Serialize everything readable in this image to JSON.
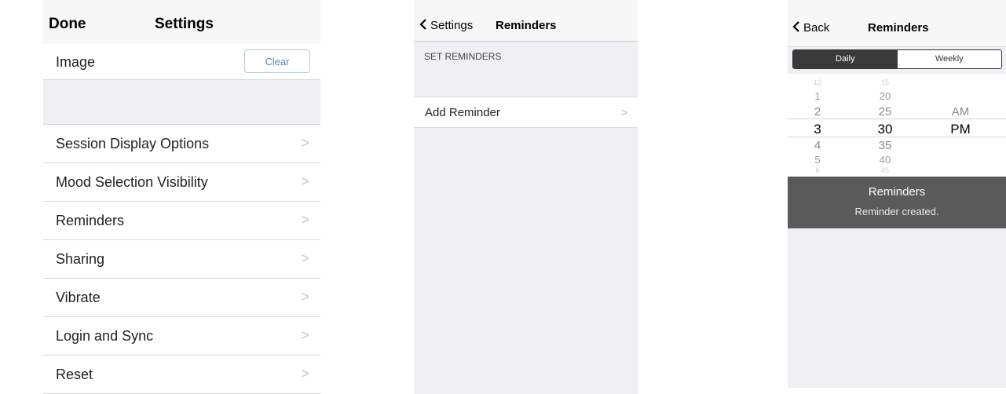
{
  "settings": {
    "nav_done": "Done",
    "nav_title": "Settings",
    "image_label": "Image",
    "clear_label": "Clear",
    "items": [
      {
        "label": "Session Display Options"
      },
      {
        "label": "Mood Selection Visibility"
      },
      {
        "label": "Reminders"
      },
      {
        "label": "Sharing"
      },
      {
        "label": "Vibrate"
      },
      {
        "label": "Login and Sync"
      },
      {
        "label": "Reset"
      }
    ],
    "chevron": ">"
  },
  "reminders": {
    "nav_back": "Settings",
    "nav_title": "Reminders",
    "section_header": "SET REMINDERS",
    "add_label": "Add Reminder",
    "chevron": ">"
  },
  "picker_screen": {
    "nav_back": "Back",
    "nav_title": "Reminders",
    "segments": [
      "Daily",
      "Weekly"
    ],
    "selected_segment": "Daily",
    "hours": [
      "12",
      "1",
      "2",
      "3",
      "4",
      "5",
      "6"
    ],
    "minutes": [
      "15",
      "20",
      "25",
      "30",
      "35",
      "40",
      "45"
    ],
    "ampm": [
      "AM",
      "PM"
    ],
    "selected": {
      "hour": "3",
      "minute": "30",
      "ampm": "PM"
    },
    "toast_title": "Reminders",
    "toast_message": "Reminder created."
  },
  "colors": {
    "nav_bg": "#f7f7f7",
    "group_bg": "#efeff4",
    "clear_text": "#5b86b5",
    "toast_bg": "#5a5a5a",
    "segment_selected": "#3a3a3a"
  }
}
